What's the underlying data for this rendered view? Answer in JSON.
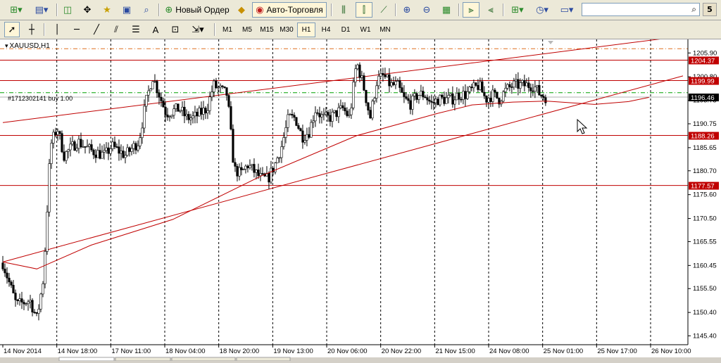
{
  "toolbar_main": {
    "new_order_label": "Новый Ордер",
    "auto_trading_label": "Авто-Торговля",
    "search_placeholder": "",
    "help_label": "5"
  },
  "toolbar_timeframes": [
    "M1",
    "M5",
    "M15",
    "M30",
    "H1",
    "H4",
    "D1",
    "W1",
    "MN"
  ],
  "active_timeframe": "H1",
  "chart_data": {
    "type": "candlestick",
    "symbol_label": "XAUUSD,H1",
    "order_label": "#1712302141 buy 1.00",
    "ylim": [
      1143.5,
      1208.5
    ],
    "y_ticks": [
      1145.4,
      1150.4,
      1155.5,
      1160.45,
      1165.55,
      1170.5,
      1175.6,
      1180.7,
      1185.65,
      1190.75,
      1195.75,
      1200.8,
      1205.9
    ],
    "x_labels": [
      "14 Nov 2014",
      "14 Nov 18:00",
      "17 Nov 11:00",
      "18 Nov 04:00",
      "18 Nov 20:00",
      "19 Nov 13:00",
      "20 Nov 06:00",
      "20 Nov 22:00",
      "21 Nov 15:00",
      "24 Nov 08:00",
      "25 Nov 01:00",
      "25 Nov 17:00",
      "26 Nov 10:00"
    ],
    "horizontal_levels": [
      {
        "price": 1204.37,
        "label": "1204.37",
        "color": "#c00000"
      },
      {
        "price": 1199.99,
        "label": "1199.99",
        "color": "#c00000"
      },
      {
        "price": 1188.26,
        "label": "1188.26",
        "color": "#c00000"
      },
      {
        "price": 1177.57,
        "label": "1177.57",
        "color": "#c00000"
      }
    ],
    "take_profit_level": 1206.8,
    "order_level": 1197.4,
    "current_price": {
      "price": 1196.46,
      "label": "1196.46"
    },
    "upper_trend_points": [
      [
        0,
        1191.0
      ],
      [
        100,
        1209.5
      ]
    ],
    "lower_trend_points": [
      [
        0,
        1161.2
      ],
      [
        100,
        1201.0
      ]
    ],
    "ma_points": [
      [
        0,
        1161.2
      ],
      [
        5,
        1159.7
      ],
      [
        13,
        1164.8
      ],
      [
        25,
        1170.3
      ],
      [
        38,
        1179.6
      ],
      [
        52,
        1188.2
      ],
      [
        64,
        1193.0
      ],
      [
        69,
        1194.8
      ],
      [
        75,
        1195.4
      ],
      [
        80,
        1195.6
      ],
      [
        87,
        1194.9
      ],
      [
        92,
        1195.5
      ],
      [
        95,
        1196.4
      ]
    ],
    "close_path": [
      [
        0,
        1161
      ],
      [
        2,
        1152
      ],
      [
        4,
        1153
      ],
      [
        5,
        1149
      ],
      [
        6,
        1158
      ],
      [
        7,
        1186
      ],
      [
        8,
        1190
      ],
      [
        9,
        1184
      ],
      [
        11,
        1187
      ],
      [
        13,
        1185
      ],
      [
        15,
        1184
      ],
      [
        16,
        1186
      ],
      [
        18,
        1184
      ],
      [
        20,
        1187
      ],
      [
        21,
        1195
      ],
      [
        22,
        1201
      ],
      [
        23,
        1197
      ],
      [
        24,
        1193
      ],
      [
        26,
        1194
      ],
      [
        27,
        1192
      ],
      [
        28,
        1192
      ],
      [
        30,
        1194
      ],
      [
        31,
        1199
      ],
      [
        32,
        1198
      ],
      [
        33,
        1197
      ],
      [
        34,
        1181
      ],
      [
        35,
        1180
      ],
      [
        36,
        1182
      ],
      [
        38,
        1179
      ],
      [
        39,
        1179
      ],
      [
        40,
        1182
      ],
      [
        41,
        1186
      ],
      [
        42,
        1192
      ],
      [
        43,
        1192
      ],
      [
        44,
        1188
      ],
      [
        45,
        1189
      ],
      [
        46,
        1194
      ],
      [
        47,
        1192
      ],
      [
        48,
        1192
      ],
      [
        50,
        1194
      ],
      [
        51,
        1192
      ],
      [
        52,
        1204
      ],
      [
        53,
        1199
      ],
      [
        54,
        1192
      ],
      [
        55,
        1200
      ],
      [
        56,
        1201
      ],
      [
        57,
        1199
      ],
      [
        58,
        1199
      ],
      [
        59,
        1196
      ],
      [
        60,
        1195
      ],
      [
        61,
        1197
      ],
      [
        62,
        1197
      ],
      [
        63,
        1195
      ],
      [
        64,
        1196
      ],
      [
        66,
        1196
      ],
      [
        67,
        1197
      ],
      [
        68,
        1197
      ],
      [
        70,
        1199
      ],
      [
        71,
        1196
      ],
      [
        72,
        1197
      ],
      [
        73,
        1196
      ],
      [
        74,
        1198
      ],
      [
        75,
        1199
      ],
      [
        76,
        1199
      ],
      [
        78,
        1199
      ],
      [
        79,
        1197
      ],
      [
        79.8,
        1196.5
      ]
    ]
  }
}
